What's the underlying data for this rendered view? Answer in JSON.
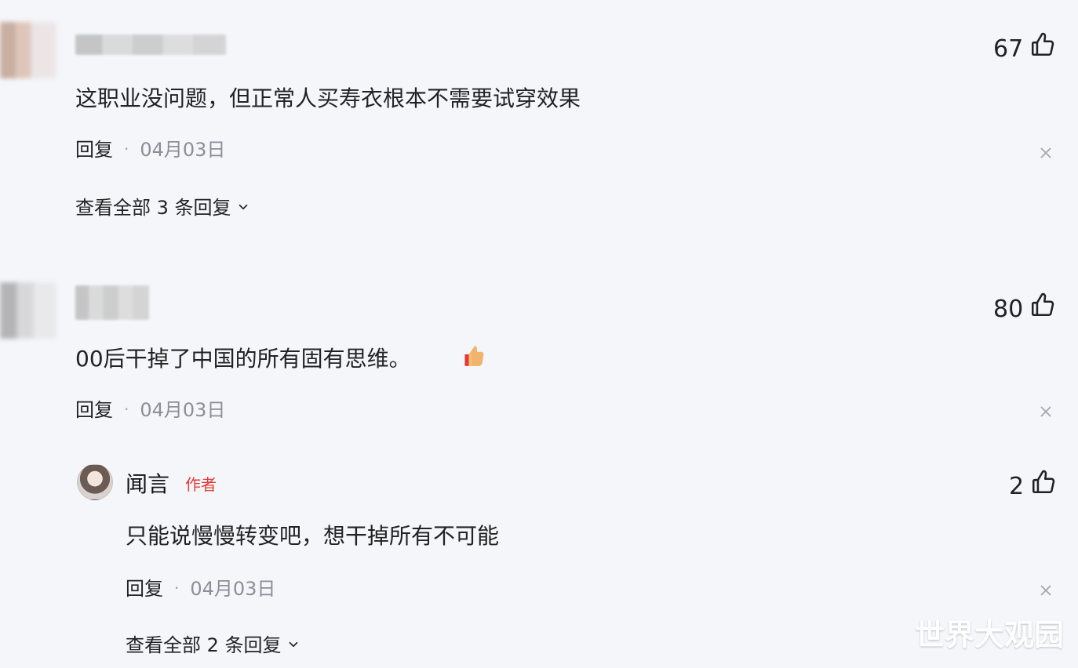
{
  "comments": [
    {
      "likes": "67",
      "content": "这职业没问题，但正常人买寿衣根本不需要试穿效果",
      "reply_label": "回复",
      "date": "04月03日",
      "view_replies": "查看全部 3 条回复"
    },
    {
      "likes": "80",
      "content": "00后干掉了中国的所有固有思维。",
      "reply_label": "回复",
      "date": "04月03日",
      "reply": {
        "author": "闻言",
        "author_badge": "作者",
        "likes": "2",
        "content": "只能说慢慢转变吧，想干掉所有不可能",
        "reply_label": "回复",
        "date": "04月03日",
        "view_replies": "查看全部 2 条回复"
      }
    }
  ],
  "ui": {
    "dot": "·",
    "watermark": "世界大观园",
    "icons": {
      "like": "thumbs-up-outline-icon",
      "close": "close-icon",
      "chevron": "chevron-down-icon",
      "emoji": "thumbs-up-emoji-icon"
    },
    "colors": {
      "background": "#f5f6fa",
      "author_badge": "#e53935",
      "muted_text": "#8a8f98"
    }
  }
}
